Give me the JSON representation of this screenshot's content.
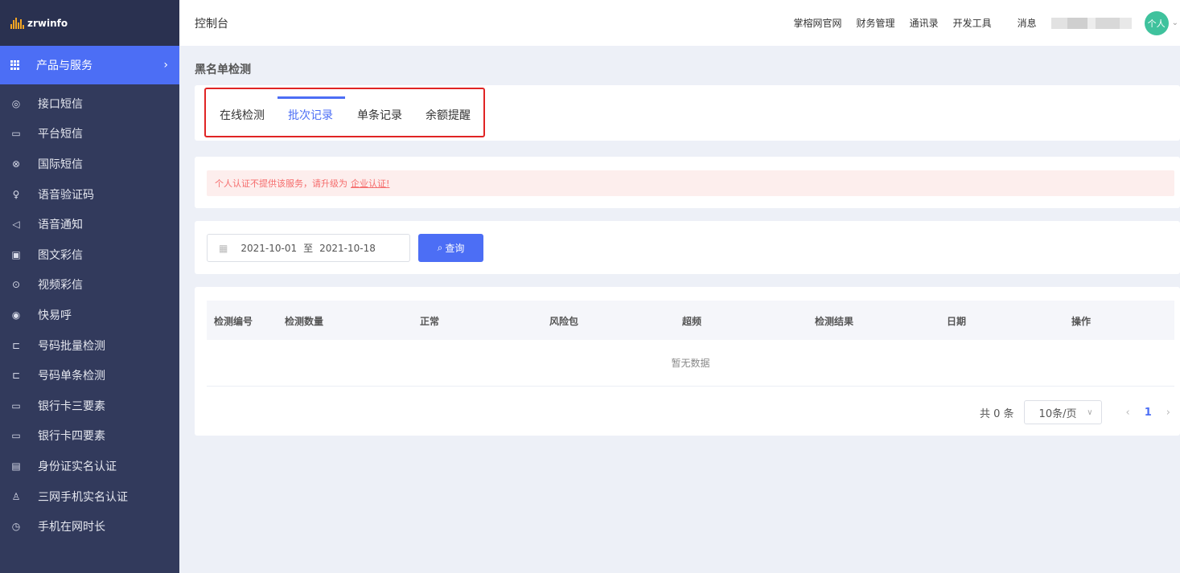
{
  "brand": {
    "name": "zrwinfo"
  },
  "sidebar": {
    "products_label": "产品与服务",
    "items": [
      {
        "label": "接口短信",
        "icon": "message-circle-icon"
      },
      {
        "label": "平台短信",
        "icon": "chat-icon"
      },
      {
        "label": "国际短信",
        "icon": "globe-icon"
      },
      {
        "label": "语音验证码",
        "icon": "microphone-icon"
      },
      {
        "label": "语音通知",
        "icon": "speaker-icon"
      },
      {
        "label": "图文彩信",
        "icon": "image-icon"
      },
      {
        "label": "视频彩信",
        "icon": "play-circle-icon"
      },
      {
        "label": "快易呼",
        "icon": "phone-call-icon"
      },
      {
        "label": "号码批量检测",
        "icon": "scan-icon"
      },
      {
        "label": "号码单条检测",
        "icon": "scan-icon"
      },
      {
        "label": "银行卡三要素",
        "icon": "card-icon"
      },
      {
        "label": "银行卡四要素",
        "icon": "card-icon"
      },
      {
        "label": "身份证实名认证",
        "icon": "id-card-icon"
      },
      {
        "label": "三网手机实名认证",
        "icon": "user-check-icon"
      },
      {
        "label": "手机在网时长",
        "icon": "clock-icon"
      }
    ]
  },
  "header": {
    "title": "控制台",
    "nav": [
      "掌榕网官网",
      "财务管理",
      "通讯录",
      "开发工具"
    ],
    "messages": "消息",
    "avatar_text": "个人"
  },
  "page": {
    "title": "黑名单检测"
  },
  "tabs": [
    {
      "label": "在线检测",
      "active": false
    },
    {
      "label": "批次记录",
      "active": true
    },
    {
      "label": "单条记录",
      "active": false
    },
    {
      "label": "余额提醒",
      "active": false
    }
  ],
  "notice": {
    "text": "个人认证不提供该服务，请升级为",
    "link": "企业认证!"
  },
  "filter": {
    "start_date": "2021-10-01",
    "separator": "至",
    "end_date": "2021-10-18",
    "query_label": "查询"
  },
  "table": {
    "columns": [
      "检测编号",
      "检测数量",
      "正常",
      "风险包",
      "超频",
      "检测结果",
      "日期",
      "操作"
    ],
    "rows": [],
    "empty_text": "暂无数据"
  },
  "pagination": {
    "total": "共 0 条",
    "page_size": "10条/页",
    "current_page": "1"
  },
  "colors": {
    "accent": "#4c6ef5",
    "sidebar": "#323a5c",
    "highlight_box": "#e02424",
    "alert_text": "#f56c6c"
  }
}
